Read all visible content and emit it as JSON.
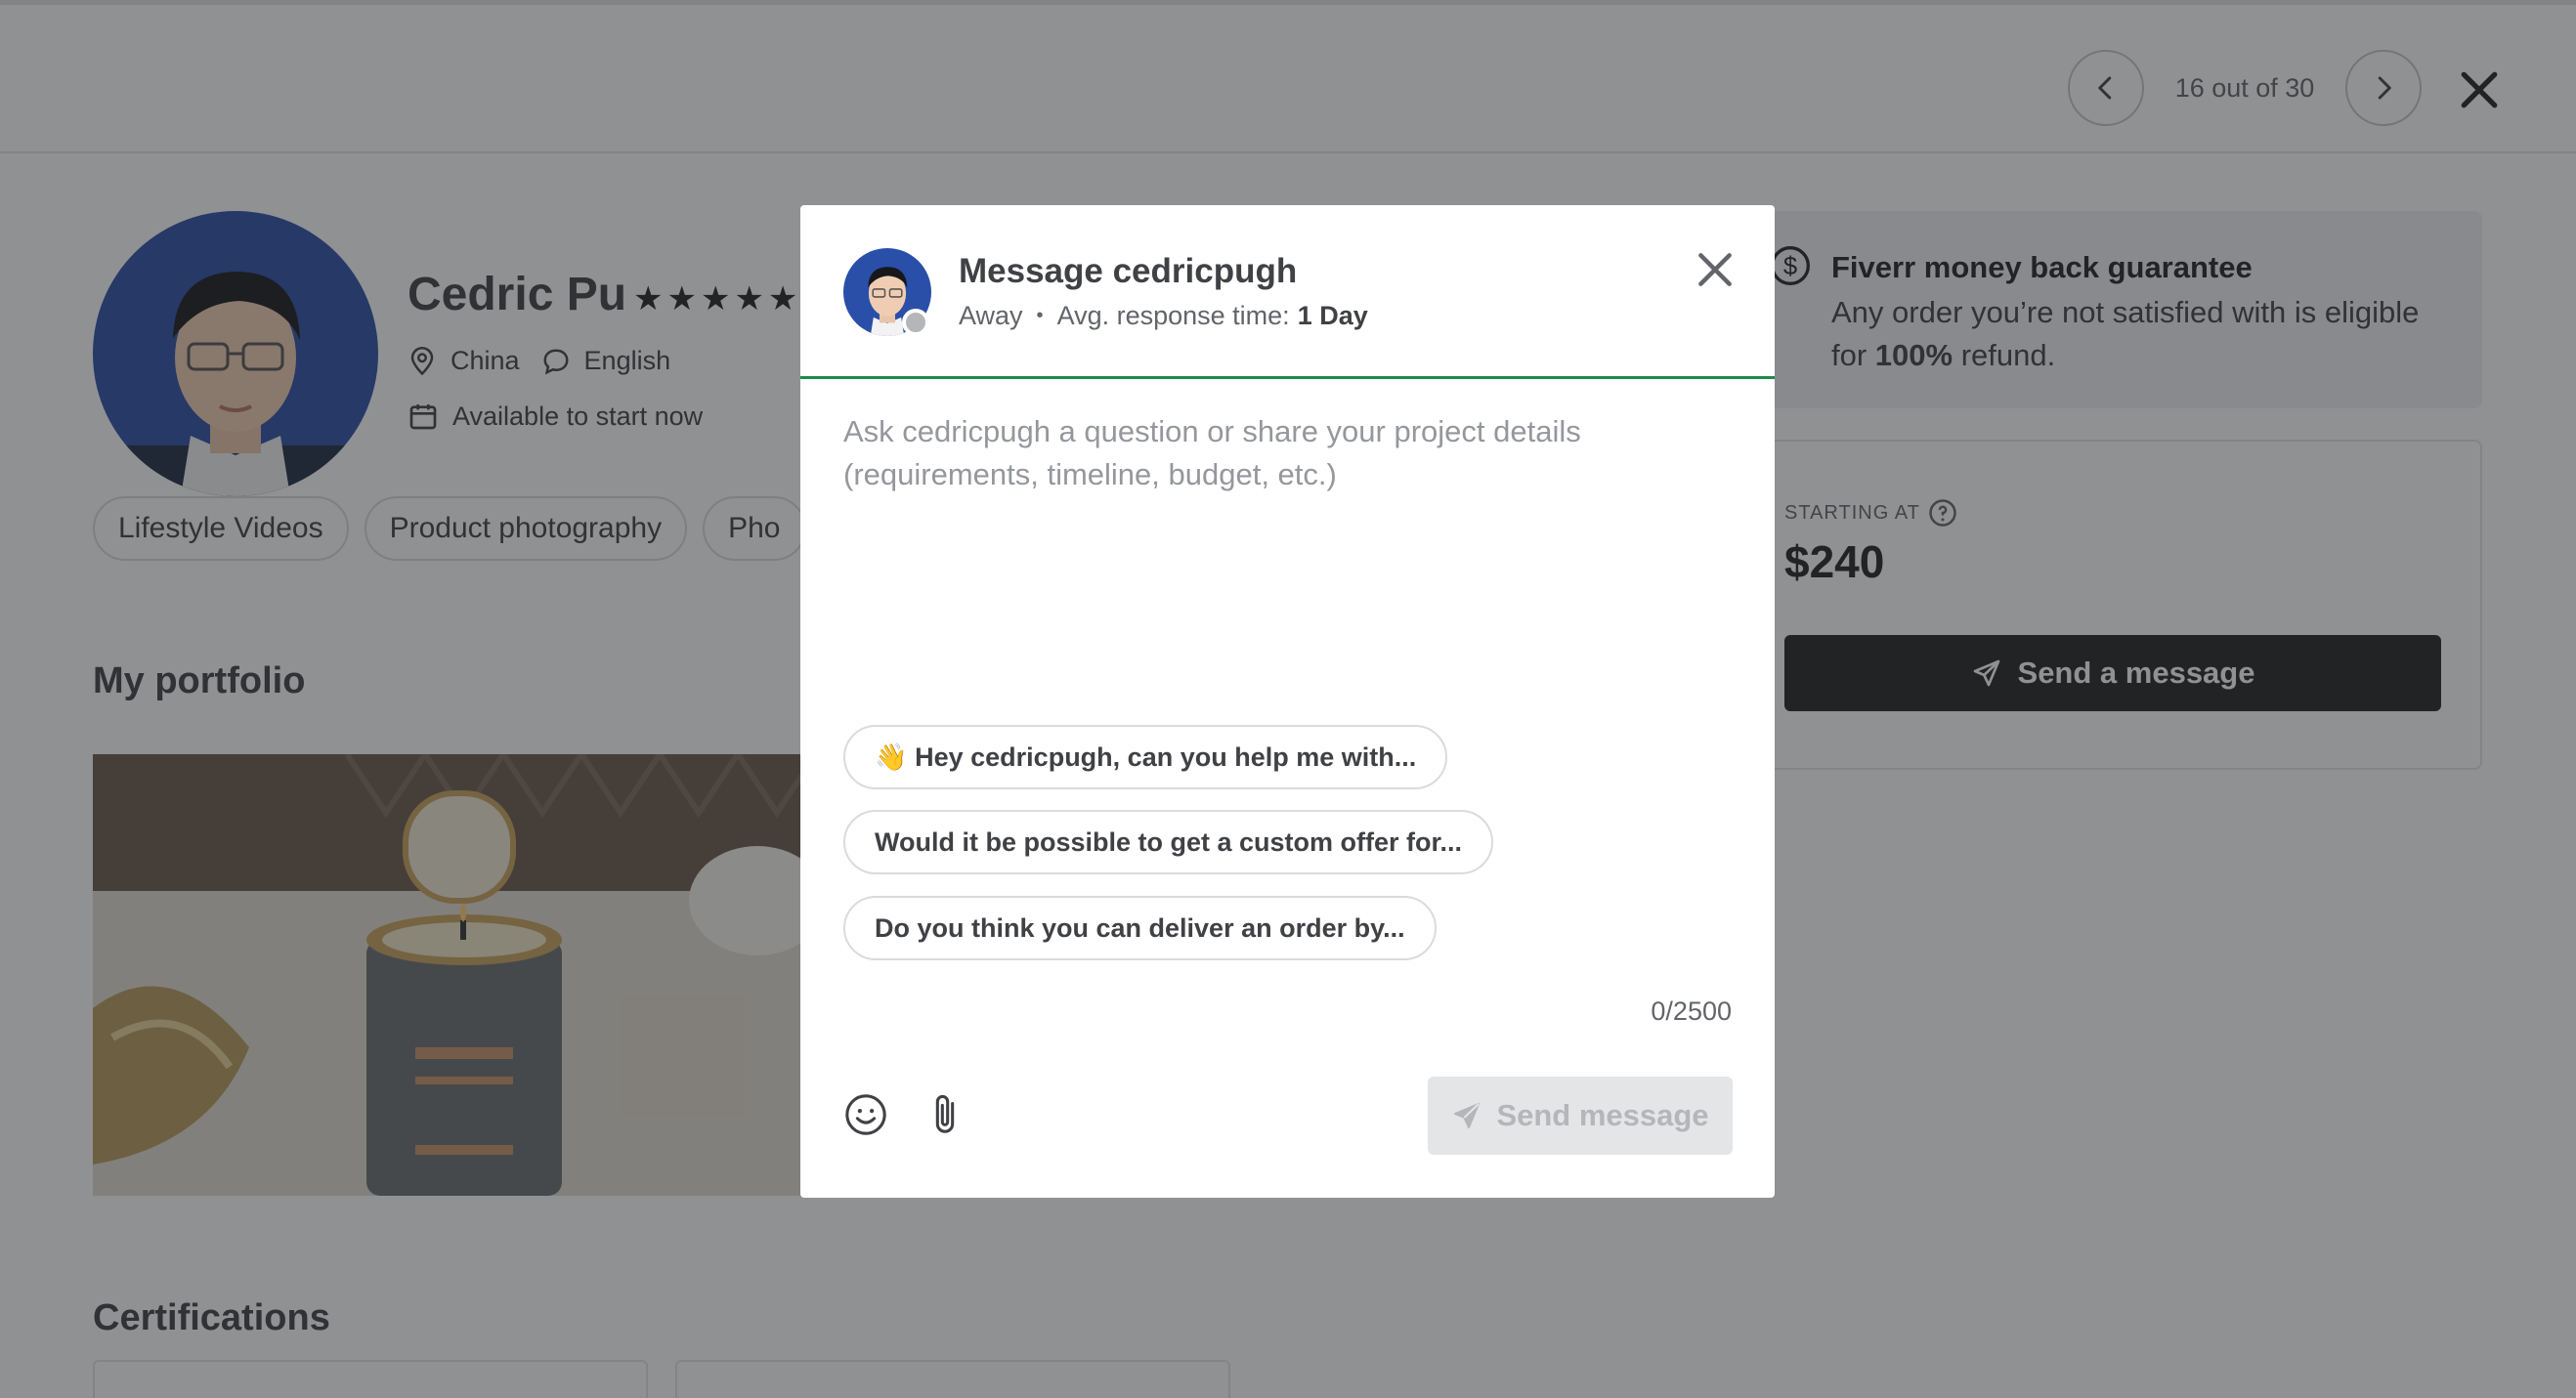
{
  "navigation": {
    "counter": "16 out of 30",
    "prev_icon": "chevron-left-icon",
    "next_icon": "chevron-right-icon",
    "close_icon": "close-icon"
  },
  "seller": {
    "name": "Cedric Pu",
    "rating_stars": "★★★★★",
    "country": "China",
    "language": "English",
    "availability": "Available to start now",
    "skills": [
      "Lifestyle Videos",
      "Product photography",
      "Pho"
    ]
  },
  "sections": {
    "portfolio_title": "My portfolio",
    "certifications_title": "Certifications"
  },
  "guarantee": {
    "title": "Fiverr money back guarantee",
    "text_before": "Any order you’re not satisfied with is eligible for ",
    "text_bold": "100%",
    "text_after": " refund."
  },
  "pricing": {
    "starting_label": "STARTING AT",
    "price": "$240",
    "cta_label": "Send a message"
  },
  "modal": {
    "title": "Message cedricpugh",
    "status": "Away",
    "response_label": "Avg. response time:",
    "response_value": "1 Day",
    "input_placeholder": "Ask cedricpugh a question or share your project details (requirements, timeline, budget, etc.)",
    "input_value": "",
    "suggestions": [
      "👋 Hey cedricpugh, can you help me with...",
      "Would it be possible to get a custom offer for...",
      "Do you think you can deliver an order by..."
    ],
    "char_count": "0/2500",
    "send_label": "Send message"
  },
  "colors": {
    "overlay": "#222325",
    "accent_green": "#1d8a4e",
    "primary_button": "#222325",
    "disabled_button": "#e4e5e7"
  }
}
